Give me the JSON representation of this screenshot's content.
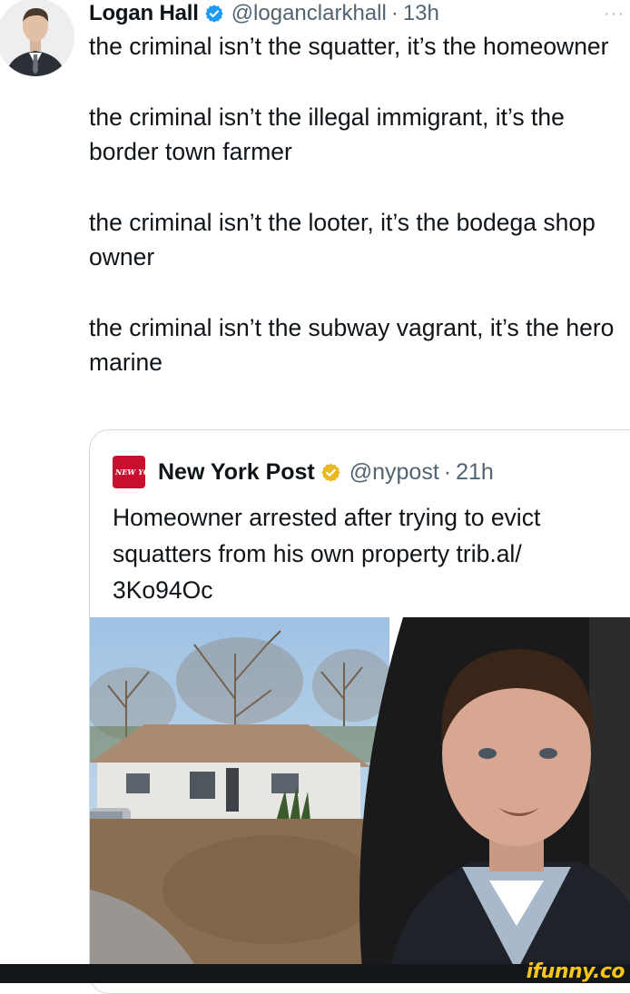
{
  "tweet": {
    "author_name": "Logan Hall",
    "handle": "@loganclarkhall",
    "separator": "·",
    "time": "13h",
    "more": "···",
    "paragraphs": [
      "the criminal isn’t the squatter, it’s the homeowner",
      "the criminal isn’t the illegal immigrant, it’s the border town farmer",
      "the criminal isn’t the looter, it’s the bodega shop owner",
      "the criminal isn’t the subway vagrant, it’s the hero marine"
    ],
    "verified_color": "#1d9bf0"
  },
  "quoted_tweet": {
    "logo_text": "NEW YORK POST",
    "author_name": "New York Post",
    "handle": "@nypost",
    "separator": "·",
    "time": "21h",
    "text": "Homeowner arrested after trying to evict squatters from his own property trib.al/ 3Ko94Oc",
    "verified_color": "#e8b923",
    "logo_color": "#c8102e"
  },
  "watermark": {
    "text": "ifunny.co"
  }
}
